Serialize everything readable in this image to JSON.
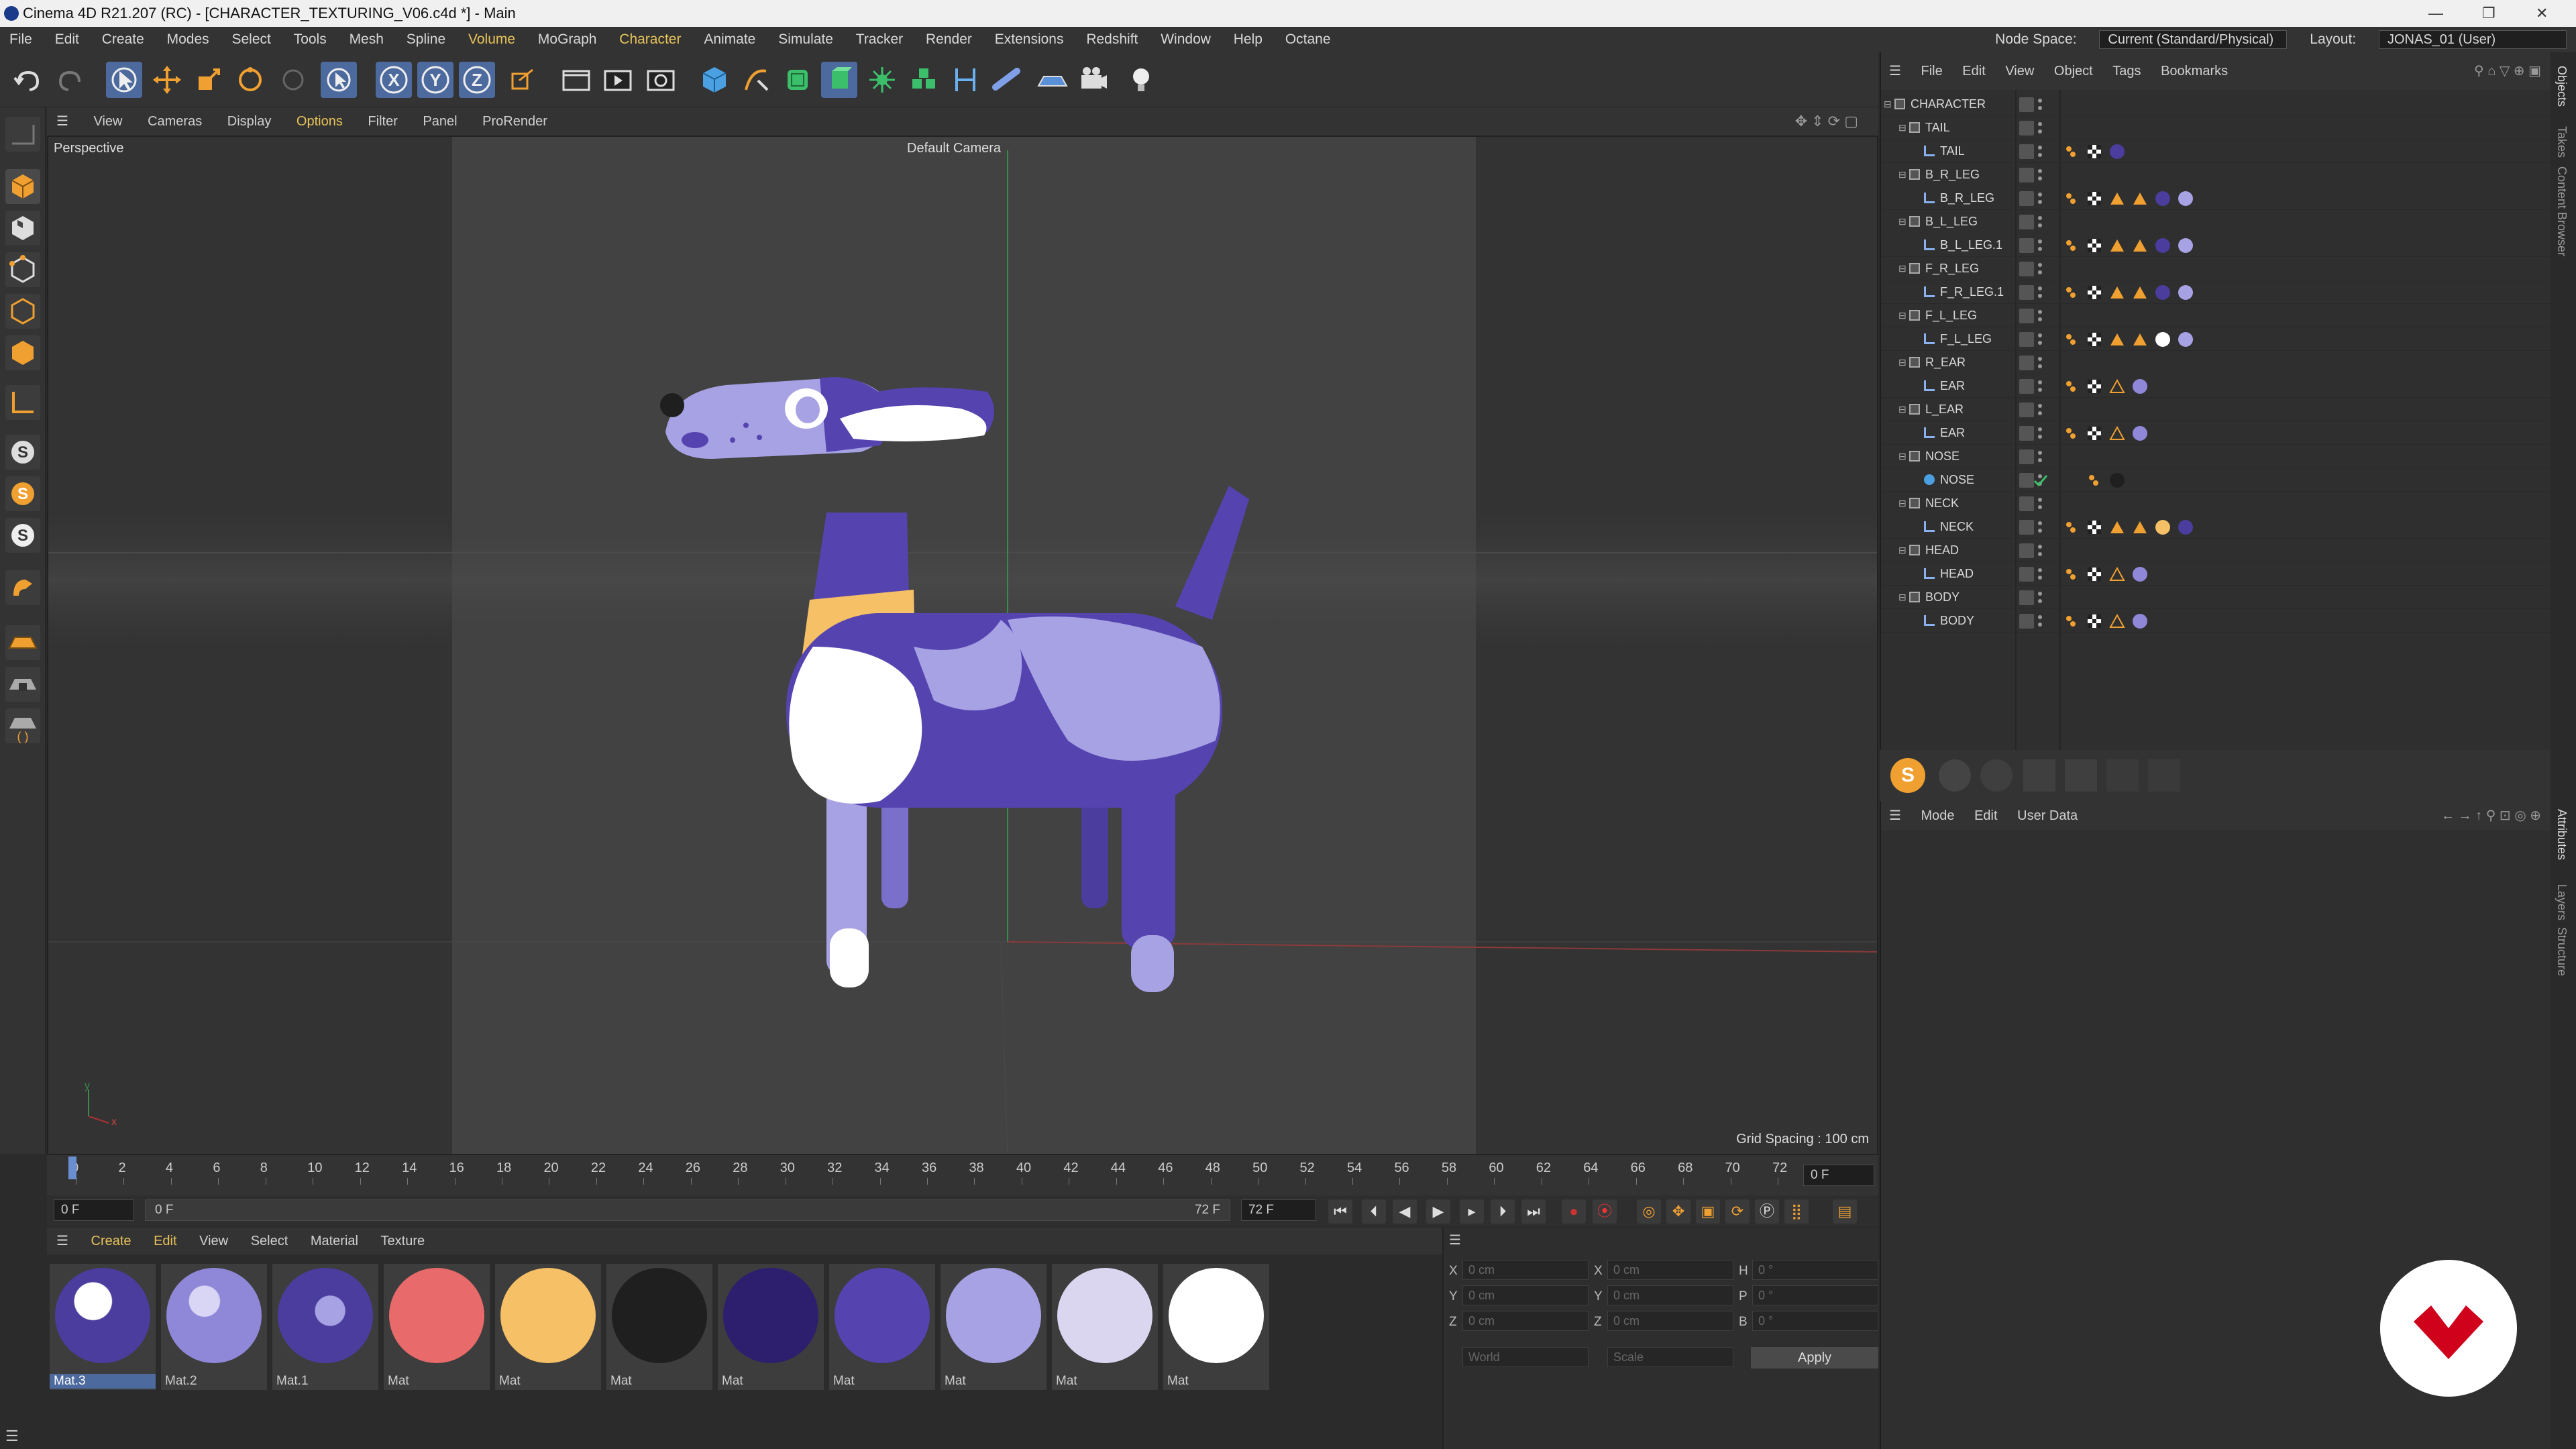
{
  "window": {
    "title": "Cinema 4D R21.207 (RC) - [CHARACTER_TEXTURING_V06.c4d *] - Main",
    "minimize": "—",
    "restore": "❐",
    "close": "✕"
  },
  "menubar": {
    "items": [
      "File",
      "Edit",
      "Create",
      "Modes",
      "Select",
      "Tools",
      "Mesh",
      "Spline",
      "Volume",
      "MoGraph",
      "Character",
      "Animate",
      "Simulate",
      "Tracker",
      "Render",
      "Extensions",
      "Redshift",
      "Window",
      "Help",
      "Octane"
    ],
    "node_space_label": "Node Space:",
    "node_space_value": "Current (Standard/Physical)",
    "layout_label": "Layout:",
    "layout_value": "JONAS_01 (User)"
  },
  "viewport": {
    "menu": [
      "View",
      "Cameras",
      "Display",
      "Options",
      "Filter",
      "Panel",
      "ProRender"
    ],
    "name": "Perspective",
    "camera": "Default Camera",
    "grid_spacing": "Grid Spacing : 100 cm",
    "axis_y": "y",
    "axis_x": "x"
  },
  "timeline": {
    "ticks": [
      "0",
      "2",
      "4",
      "6",
      "8",
      "10",
      "12",
      "14",
      "16",
      "18",
      "20",
      "22",
      "24",
      "26",
      "28",
      "30",
      "32",
      "34",
      "36",
      "38",
      "40",
      "42",
      "44",
      "46",
      "48",
      "50",
      "52",
      "54",
      "56",
      "58",
      "60",
      "62",
      "64",
      "66",
      "68",
      "70",
      "72"
    ],
    "current_frame": "0 F",
    "start": "0 F",
    "range_start": "0 F",
    "range_end": "72 F",
    "end": "72 F"
  },
  "materials": {
    "menu": [
      "Create",
      "Edit",
      "View",
      "Select",
      "Material",
      "Texture"
    ],
    "items": [
      {
        "name": "Mat.3",
        "color": "#4a3d9e"
      },
      {
        "name": "Mat.2",
        "color": "#8f88d8"
      },
      {
        "name": "Mat.1",
        "color": "#4a3d9e"
      },
      {
        "name": "Mat",
        "color": "#e86a6a"
      },
      {
        "name": "Mat",
        "color": "#f5c066"
      },
      {
        "name": "Mat",
        "color": "#1f1f1f"
      },
      {
        "name": "Mat",
        "color": "#2d1f6e"
      },
      {
        "name": "Mat",
        "color": "#5544b0"
      },
      {
        "name": "Mat",
        "color": "#a7a2e4"
      },
      {
        "name": "Mat",
        "color": "#dad6f0"
      },
      {
        "name": "Mat",
        "color": "#ffffff"
      }
    ]
  },
  "coords": {
    "rows": [
      {
        "axis": "X",
        "pos": "0 cm",
        "axis2": "X",
        "size": "0 cm",
        "axis3": "H",
        "rot": "0 °"
      },
      {
        "axis": "Y",
        "pos": "0 cm",
        "axis2": "Y",
        "size": "0 cm",
        "axis3": "P",
        "rot": "0 °"
      },
      {
        "axis": "Z",
        "pos": "0 cm",
        "axis2": "Z",
        "size": "0 cm",
        "axis3": "B",
        "rot": "0 °"
      }
    ],
    "space": "World",
    "mode": "Scale",
    "apply": "Apply"
  },
  "objects": {
    "menu": [
      "File",
      "Edit",
      "View",
      "Object",
      "Tags",
      "Bookmarks"
    ],
    "tree": [
      {
        "name": "CHARACTER",
        "level": 0
      },
      {
        "name": "TAIL",
        "level": 1
      },
      {
        "name": "TAIL",
        "level": 2
      },
      {
        "name": "B_R_LEG",
        "level": 1
      },
      {
        "name": "B_R_LEG",
        "level": 2
      },
      {
        "name": "B_L_LEG",
        "level": 1
      },
      {
        "name": "B_L_LEG.1",
        "level": 2
      },
      {
        "name": "F_R_LEG",
        "level": 1
      },
      {
        "name": "F_R_LEG.1",
        "level": 2
      },
      {
        "name": "F_L_LEG",
        "level": 1
      },
      {
        "name": "F_L_LEG",
        "level": 2
      },
      {
        "name": "R_EAR",
        "level": 1
      },
      {
        "name": "EAR",
        "level": 2
      },
      {
        "name": "L_EAR",
        "level": 1
      },
      {
        "name": "EAR",
        "level": 2
      },
      {
        "name": "NOSE",
        "level": 1
      },
      {
        "name": "NOSE",
        "level": 2
      },
      {
        "name": "NECK",
        "level": 1
      },
      {
        "name": "NECK",
        "level": 2
      },
      {
        "name": "HEAD",
        "level": 1
      },
      {
        "name": "HEAD",
        "level": 2
      },
      {
        "name": "BODY",
        "level": 1
      },
      {
        "name": "BODY",
        "level": 2
      }
    ]
  },
  "attributes": {
    "menu": [
      "Mode",
      "Edit",
      "User Data"
    ]
  },
  "right_tabs": [
    "Objects",
    "Takes",
    "Content Browser",
    "Attributes",
    "Layers",
    "Structure"
  ],
  "colors": {
    "accent": "#4d6a9e",
    "dog_dark": "#5544b0",
    "dog_light": "#a7a2e4",
    "collar": "#f5c066",
    "logo_red": "#d0021b"
  }
}
